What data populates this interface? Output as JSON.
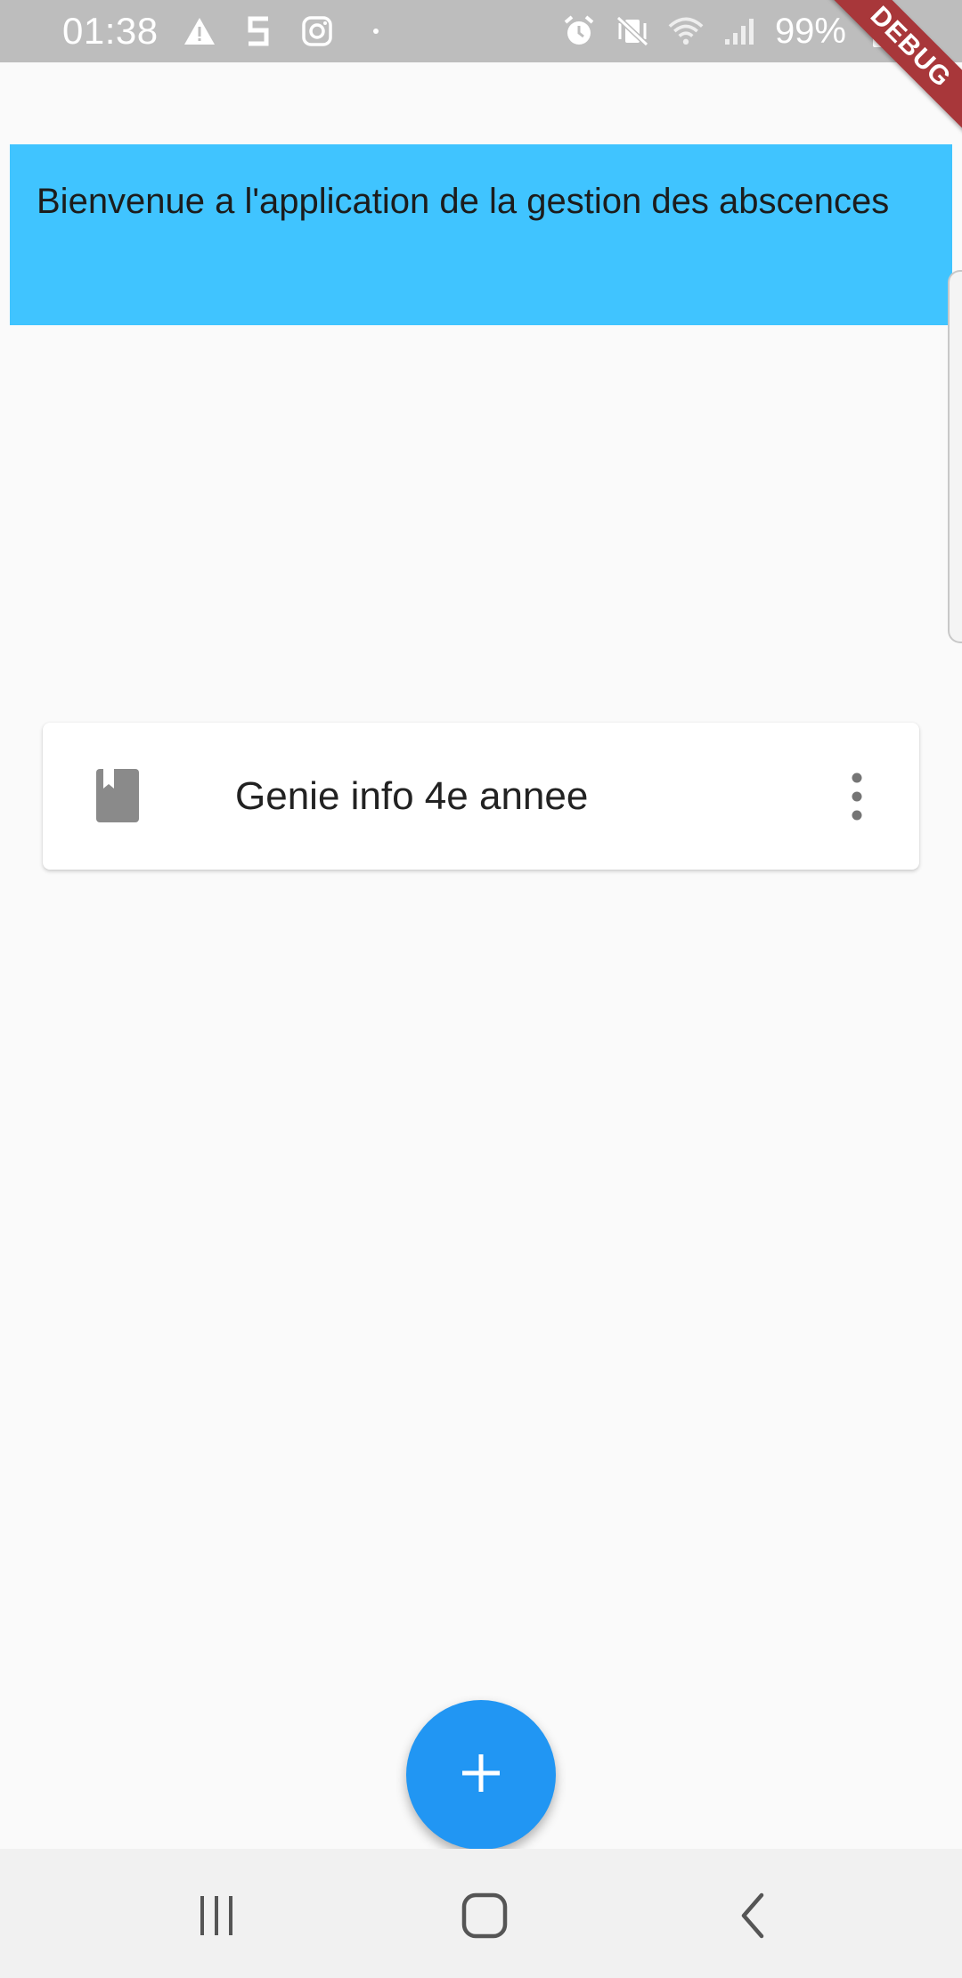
{
  "status_bar": {
    "time": "01:38",
    "battery": "99%",
    "left_icons": [
      "warning-icon",
      "s-app-icon",
      "instagram-icon",
      "dot-icon"
    ],
    "right_icons": [
      "alarm-icon",
      "vibrate-mute-icon",
      "wifi-icon",
      "signal-icon",
      "battery-charging-icon"
    ]
  },
  "debug_banner": "DEBUG",
  "header": {
    "title": "Bienvenue a l'application de la gestion des abscences",
    "background": "#40c4ff"
  },
  "list": {
    "items": [
      {
        "icon": "book-icon",
        "title": "Genie info 4e annee",
        "menu_icon": "more-vert-icon"
      }
    ]
  },
  "fab": {
    "icon": "plus-icon",
    "color": "#2196f3"
  },
  "nav_bar": {
    "buttons": [
      "recent-apps-icon",
      "home-icon",
      "back-icon"
    ]
  }
}
